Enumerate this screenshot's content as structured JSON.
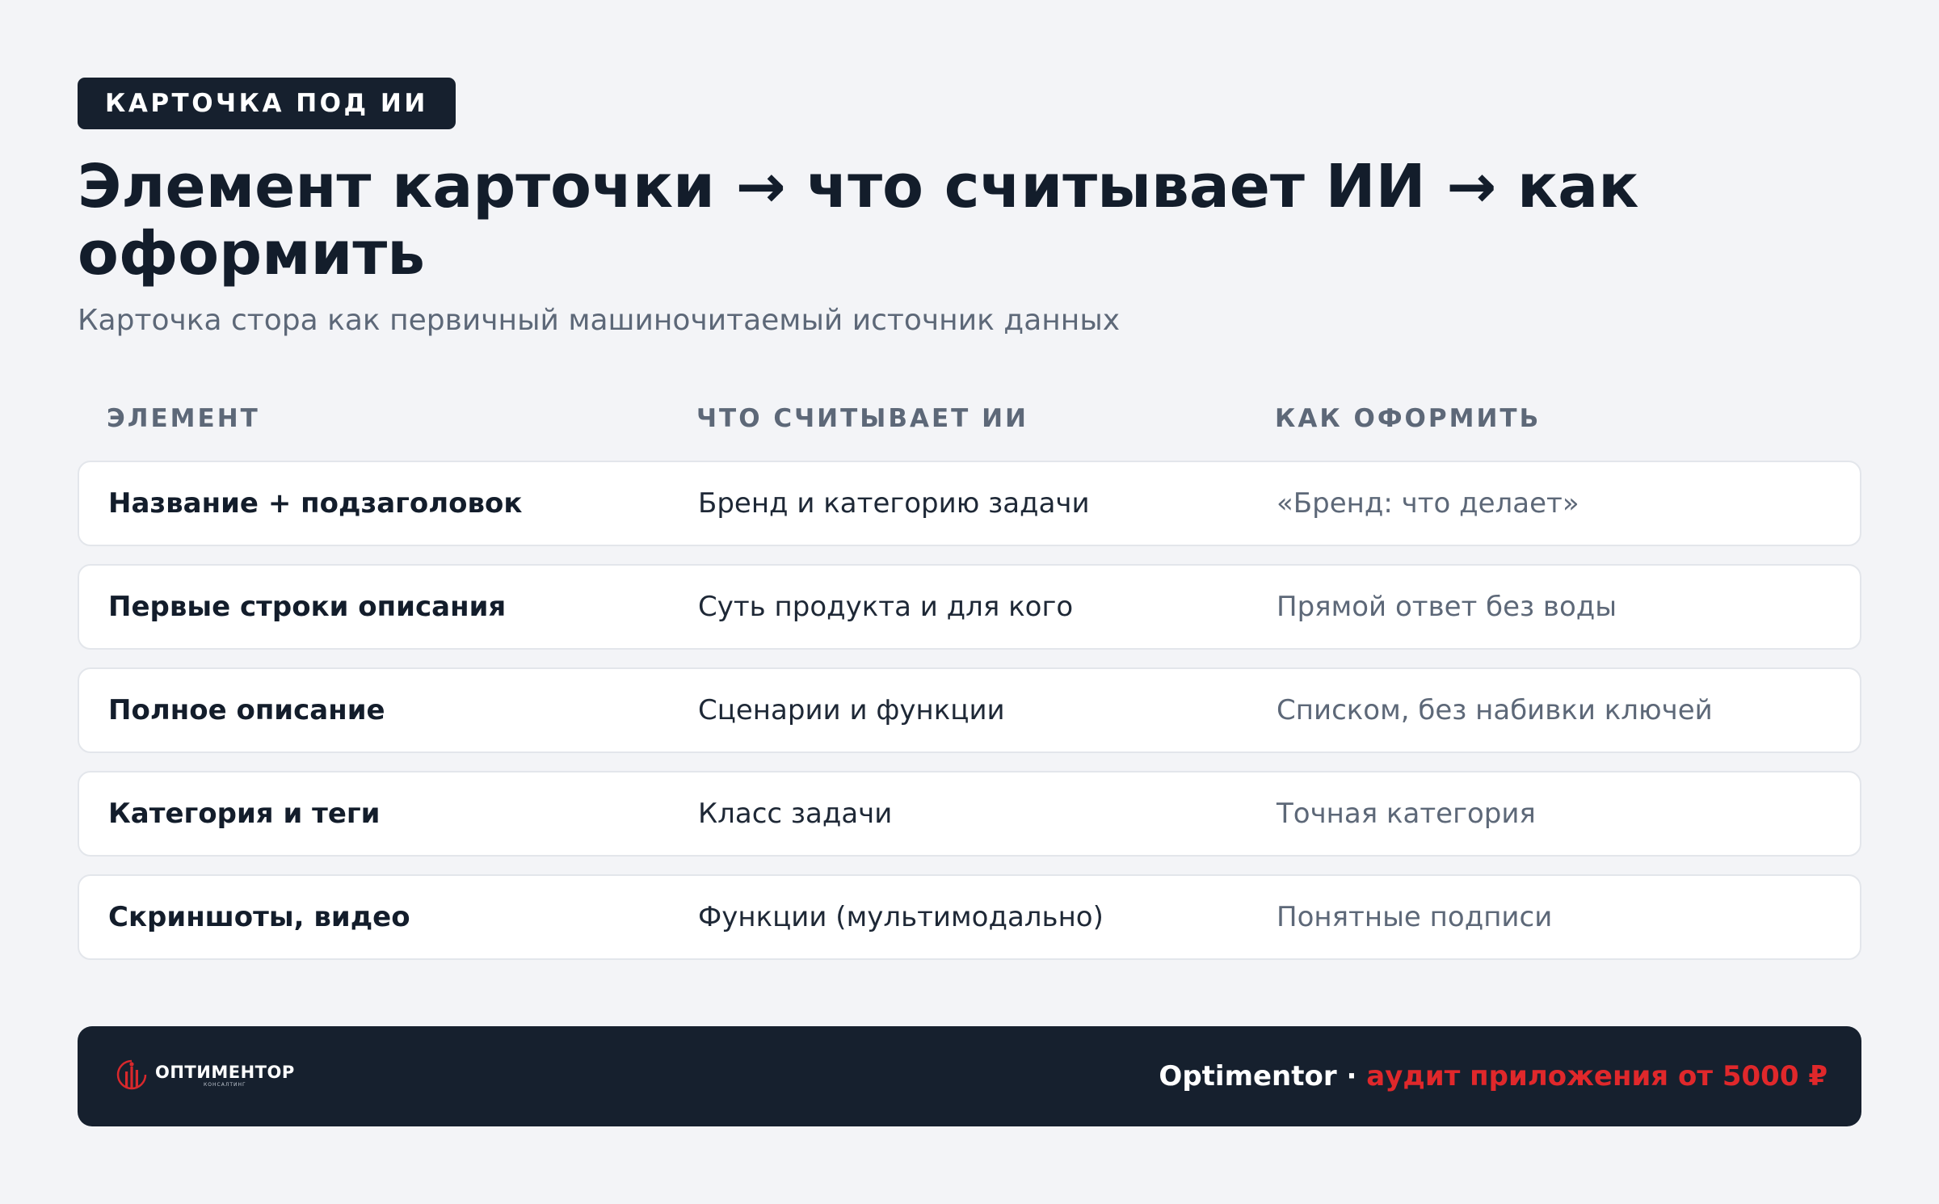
{
  "badge": "КАРТОЧКА ПОД ИИ",
  "title": "Элемент карточки → что считывает ИИ → как оформить",
  "subtitle": "Карточка стора как первичный машиночитаемый источник данных",
  "table": {
    "headers": [
      "ЭЛЕМЕНТ",
      "ЧТО СЧИТЫВАЕТ ИИ",
      "КАК ОФОРМИТЬ"
    ],
    "rows": [
      [
        "Название + подзаголовок",
        "Бренд и категорию задачи",
        "«Бренд: что делает»"
      ],
      [
        "Первые строки описания",
        "Суть продукта и для кого",
        "Прямой ответ без воды"
      ],
      [
        "Полное описание",
        "Сценарии и функции",
        "Списком, без набивки ключей"
      ],
      [
        "Категория и теги",
        "Класс задачи",
        "Точная категория"
      ],
      [
        "Скриншоты, видео",
        "Функции (мультимодально)",
        "Понятные подписи"
      ]
    ]
  },
  "footer": {
    "logo_icon": "optimentor-logo-icon",
    "logo_name": "ОПТИМЕНТОР",
    "logo_tagline": "КОНСАЛТИНГ",
    "brand": "Optimentor",
    "separator": " · ",
    "offer": "аудит приложения от 5000 ₽"
  },
  "colors": {
    "background": "#f3f4f7",
    "dark": "#16202e",
    "accent_red": "#e0282b",
    "muted": "#5d6878"
  }
}
